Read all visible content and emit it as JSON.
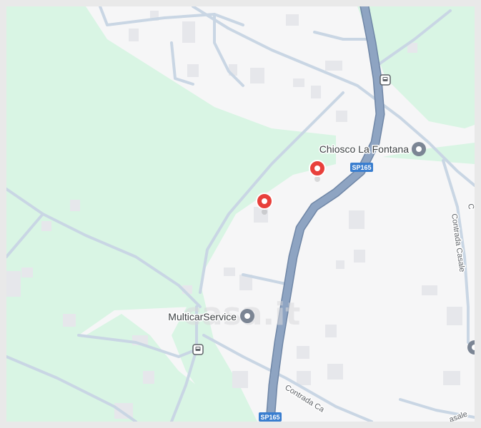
{
  "map": {
    "colors": {
      "background": "#f6f6f7",
      "park": "#d9f5e4",
      "road_minor": "#c9d6e4",
      "road_major": "#8aa0bd",
      "building": "#e7e8ec",
      "pin": "#e8403b",
      "poi": "#7b8594",
      "shield": "#3a7ecf"
    },
    "places": {
      "chiosco": {
        "label": "Chiosco La Fontana",
        "icon": "poi-dot-icon"
      },
      "multicar": {
        "label": "MulticarService",
        "icon": "poi-dot-icon"
      }
    },
    "roads": {
      "sp165_north": "SP165",
      "sp165_south": "SP165",
      "contrada_casale_vertical": "Contrada Casale",
      "contrada_casale_diagonal": "Contrada Ca",
      "contrada_casale_right": "asale",
      "edge_right": "C"
    },
    "pins": [
      {
        "name": "pin-1",
        "icon": "map-pin-icon"
      },
      {
        "name": "pin-2",
        "icon": "map-pin-icon"
      }
    ],
    "transit": [
      {
        "name": "bus-stop-north",
        "icon": "bus-icon"
      },
      {
        "name": "bus-stop-south",
        "icon": "bus-icon"
      }
    ],
    "watermark": "casa.it"
  }
}
